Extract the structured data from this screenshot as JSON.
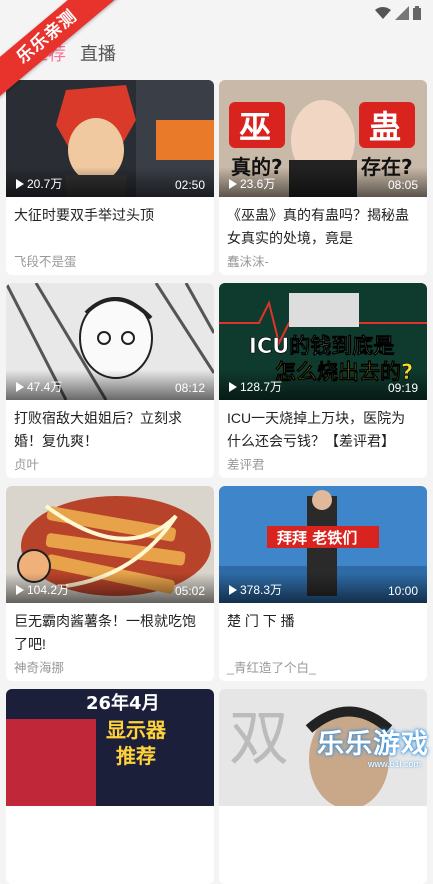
{
  "status": {
    "wifi_icon": "wifi-icon",
    "signal_icon": "signal-icon",
    "battery_icon": "battery-icon"
  },
  "ribbon": {
    "label": "乐乐亲测"
  },
  "tabs": [
    {
      "label": "推荐"
    },
    {
      "label": "直播"
    }
  ],
  "colors": {
    "accent": "#fb7299",
    "ribbon": "#e8322c"
  },
  "videos": [
    {
      "views": "20.7万",
      "duration": "02:50",
      "title": "大征时要双手举过头顶",
      "uploader": "飞段不是蛋",
      "overlay": ""
    },
    {
      "views": "23.6万",
      "duration": "08:05",
      "title": "《巫蛊》真的有蛊吗？揭秘蛊女真实的处境，竟是",
      "uploader": "蠢沫沫-",
      "overlay": "巫 蛊 真的? 存在?"
    },
    {
      "views": "47.4万",
      "duration": "08:12",
      "title": "打败宿敌大姐姐后？立刻求婚！复仇爽！",
      "uploader": "贞叶",
      "overlay": ""
    },
    {
      "views": "128.7万",
      "duration": "09:19",
      "title": "ICU一天烧掉上万块，医院为什么还会亏钱？【差评君】",
      "uploader": "差评君",
      "overlay": "ICU的钱到底是 怎么烧出去的?"
    },
    {
      "views": "104.2万",
      "duration": "05:02",
      "title": "巨无霸肉酱薯条！一根就吃饱了吧!",
      "uploader": "神奇海挪",
      "overlay": ""
    },
    {
      "views": "378.3万",
      "duration": "10:00",
      "title": "楚 门 下 播",
      "uploader": "_青红造了个白_",
      "overlay": "拜拜 老铁们"
    },
    {
      "views": "",
      "duration": "",
      "title": "",
      "uploader": "",
      "overlay": "26年4月 显示器 推荐"
    },
    {
      "views": "",
      "duration": "",
      "title": "",
      "uploader": "",
      "overlay": ""
    }
  ],
  "watermark": {
    "text": "乐乐游戏",
    "url": "www.61l.com"
  }
}
